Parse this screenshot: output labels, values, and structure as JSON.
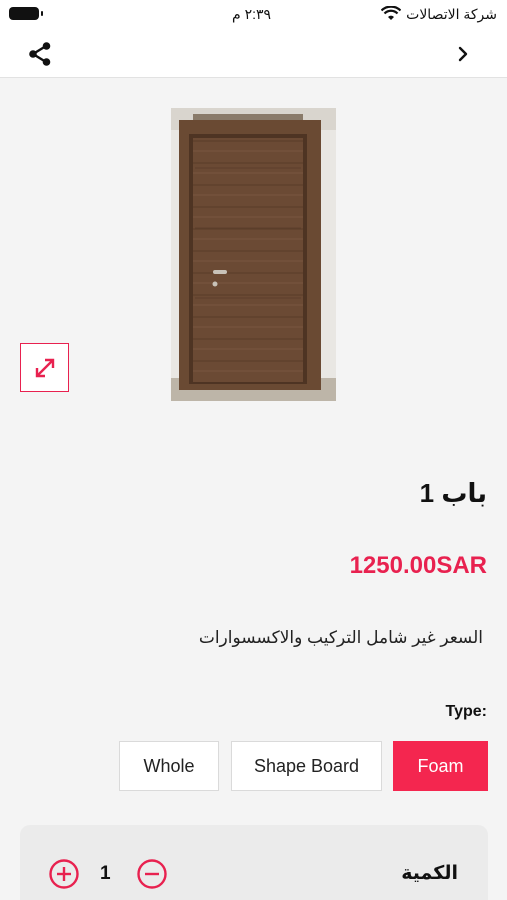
{
  "status_bar": {
    "carrier": "شركة الاتصالات",
    "time": "٢:٣٩ م"
  },
  "nav": {
    "share_icon": "share-icon",
    "back_icon": "chevron-right-icon"
  },
  "product": {
    "title": "باب 1",
    "price": "1250.00SAR",
    "note": "السعر غير شامل التركيب والاكسسوارات",
    "expand_icon": "expand-icon"
  },
  "type": {
    "label": "Type:",
    "options": [
      {
        "label": "Whole",
        "selected": false
      },
      {
        "label": "Shape Board",
        "selected": false
      },
      {
        "label": "Foam",
        "selected": true
      }
    ]
  },
  "quantity": {
    "label": "الكمية",
    "value": "1"
  },
  "colors": {
    "accent": "#e8214f",
    "selected_bg": "#f4264f"
  }
}
